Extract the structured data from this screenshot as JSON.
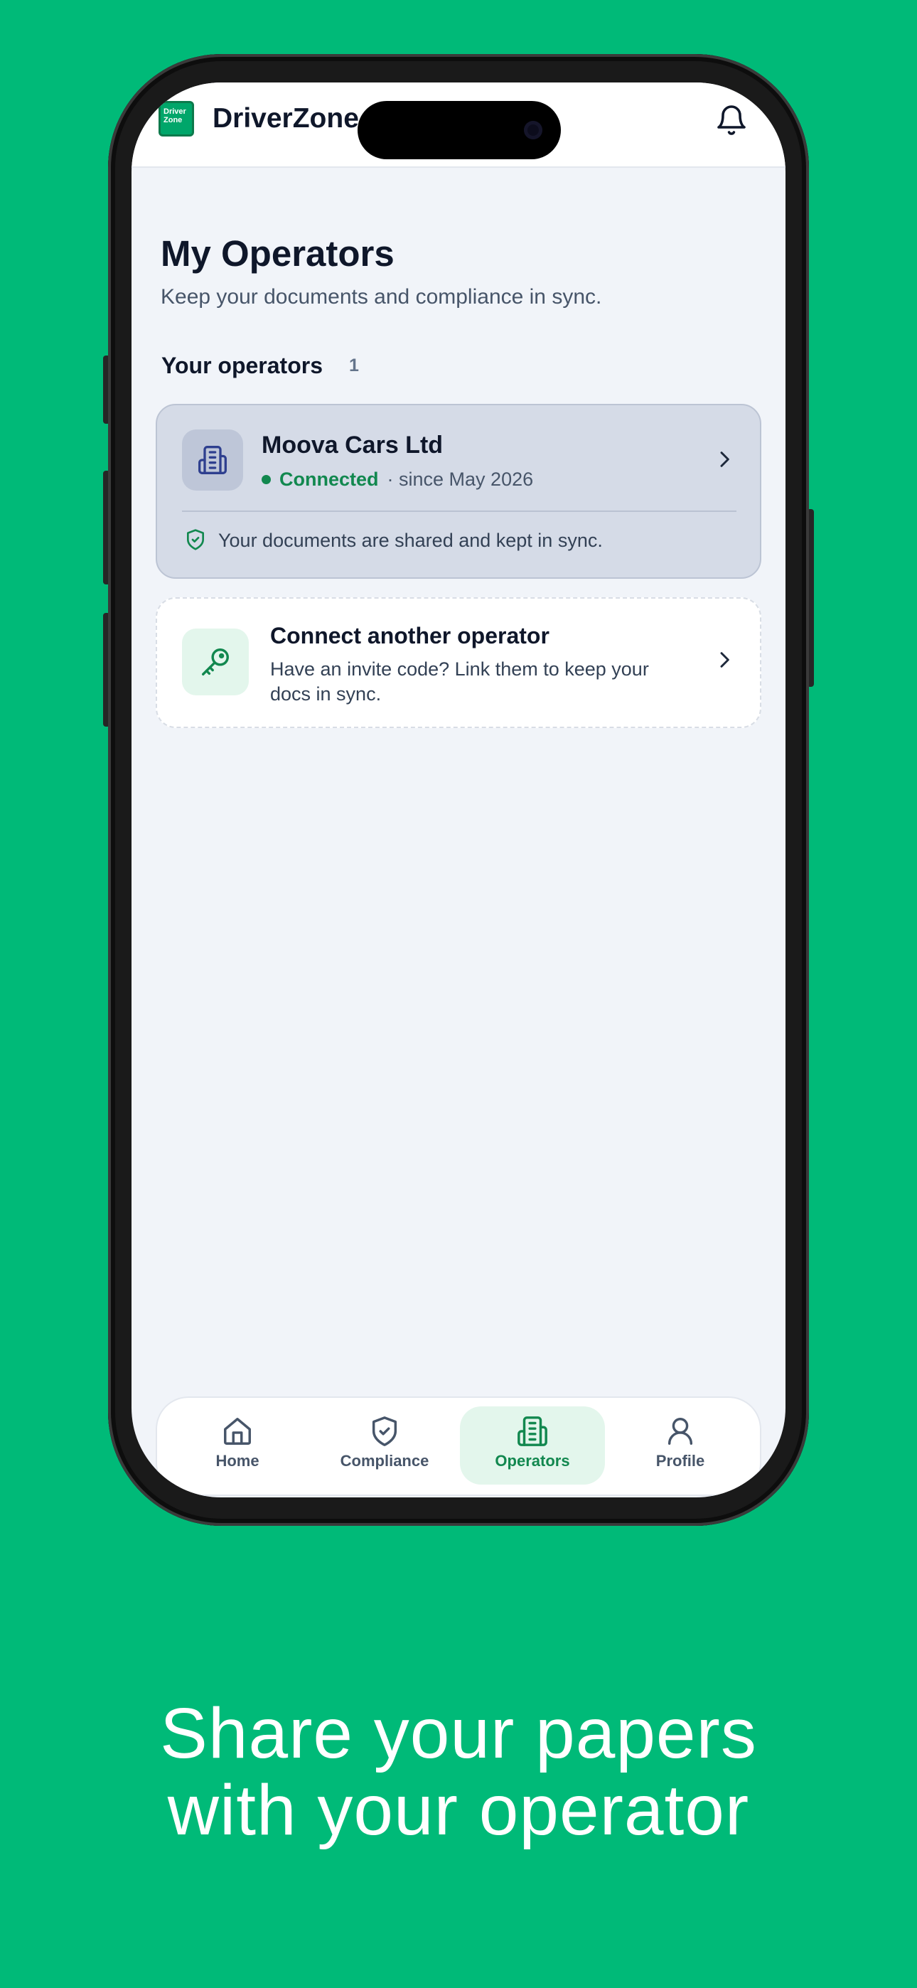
{
  "app": {
    "name": "DriverZone",
    "logo_text": [
      "Driver",
      "Zone"
    ]
  },
  "page": {
    "title": "My Operators",
    "subtitle": "Keep your documents and compliance in sync."
  },
  "operators_section": {
    "label": "Your operators",
    "count": "1"
  },
  "operators": [
    {
      "name": "Moova Cars Ltd",
      "status": "Connected",
      "since": "· since May 2026",
      "note": "Your documents are shared and kept in sync."
    }
  ],
  "connect_card": {
    "title": "Connect another operator",
    "description": "Have an invite code? Link them to keep your docs in sync."
  },
  "bottom_nav": {
    "items": [
      {
        "label": "Home",
        "icon": "home-icon",
        "active": false
      },
      {
        "label": "Compliance",
        "icon": "shield-check-icon",
        "active": false
      },
      {
        "label": "Operators",
        "icon": "building-icon",
        "active": true
      },
      {
        "label": "Profile",
        "icon": "user-icon",
        "active": false
      }
    ]
  },
  "caption": {
    "line1": "Share your papers",
    "line2": "with your operator"
  },
  "colors": {
    "background": "#00BA78",
    "accent": "#12884F",
    "operator_card": "#D5DBE7",
    "screen_bg": "#F1F4F9"
  }
}
